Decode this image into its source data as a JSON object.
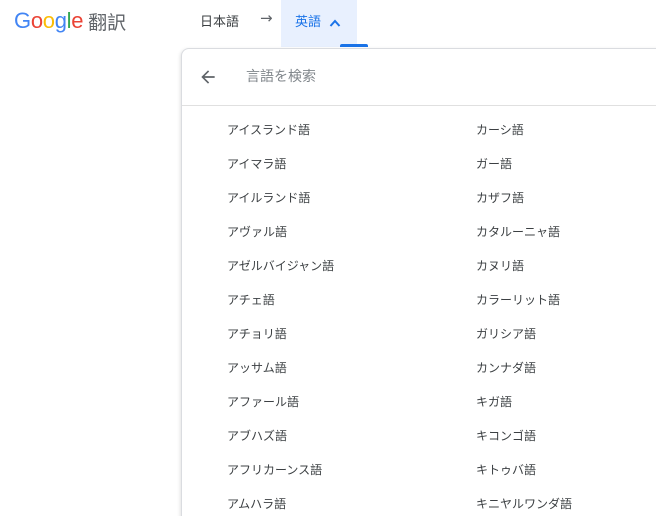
{
  "header": {
    "logo": {
      "letters": [
        {
          "char": "G",
          "color": "#4285F4"
        },
        {
          "char": "o",
          "color": "#EA4335"
        },
        {
          "char": "o",
          "color": "#FBBC05"
        },
        {
          "char": "g",
          "color": "#4285F4"
        },
        {
          "char": "l",
          "color": "#34A853"
        },
        {
          "char": "e",
          "color": "#EA4335"
        }
      ],
      "product": "翻訳"
    },
    "source_language": "日本語",
    "swap_arrow": "→",
    "target_language": "英語"
  },
  "language_picker": {
    "search_placeholder": "言語を検索",
    "left_column": [
      "アイスランド語",
      "アイマラ語",
      "アイルランド語",
      "アヴァル語",
      "アゼルバイジャン語",
      "アチェ語",
      "アチョリ語",
      "アッサム語",
      "アファール語",
      "アブハズ語",
      "アフリカーンス語",
      "アムハラ語"
    ],
    "right_column": [
      "カーシ語",
      "ガー語",
      "カザフ語",
      "カタルーニャ語",
      "カヌリ語",
      "カラーリット語",
      "ガリシア語",
      "カンナダ語",
      "キガ語",
      "キコンゴ語",
      "キトゥバ語",
      "キニヤルワンダ語"
    ]
  },
  "colors": {
    "accent": "#1a73e8",
    "tab_highlight": "#e8f0fe",
    "text": "#3c4043"
  }
}
